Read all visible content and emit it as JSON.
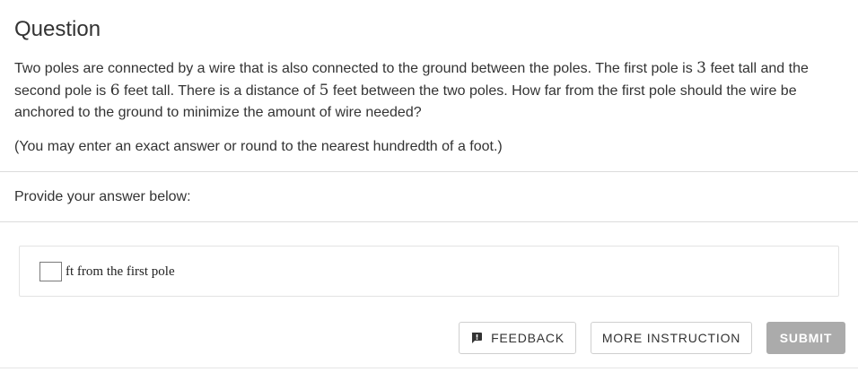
{
  "header": {
    "title": "Question"
  },
  "question": {
    "line1_a": "Two poles are connected by a wire that is also connected to the ground between the poles. The first pole is ",
    "first_pole_height": "3",
    "line1_b": " feet tall and the second pole is ",
    "second_pole_height": "6",
    "line1_c": " feet tall. There is a distance of ",
    "distance": "5",
    "line1_d": " feet between the two poles. How far from the first pole should the wire be anchored to the ground to minimize the amount of wire needed?",
    "rounding_note": "(You may enter an exact answer or round to the nearest hundredth of a foot.)"
  },
  "answer": {
    "prompt": "Provide your answer below:",
    "input_value": "",
    "unit_label": "ft from the first pole"
  },
  "actions": {
    "feedback_label": "FEEDBACK",
    "more_instruction_label": "MORE INSTRUCTION",
    "submit_label": "SUBMIT"
  },
  "icons": {
    "feedback": "feedback-chat-icon"
  },
  "colors": {
    "text": "#333333",
    "divider": "#dcdcdc",
    "submit_bg": "#ababab",
    "submit_text": "#ffffff"
  }
}
